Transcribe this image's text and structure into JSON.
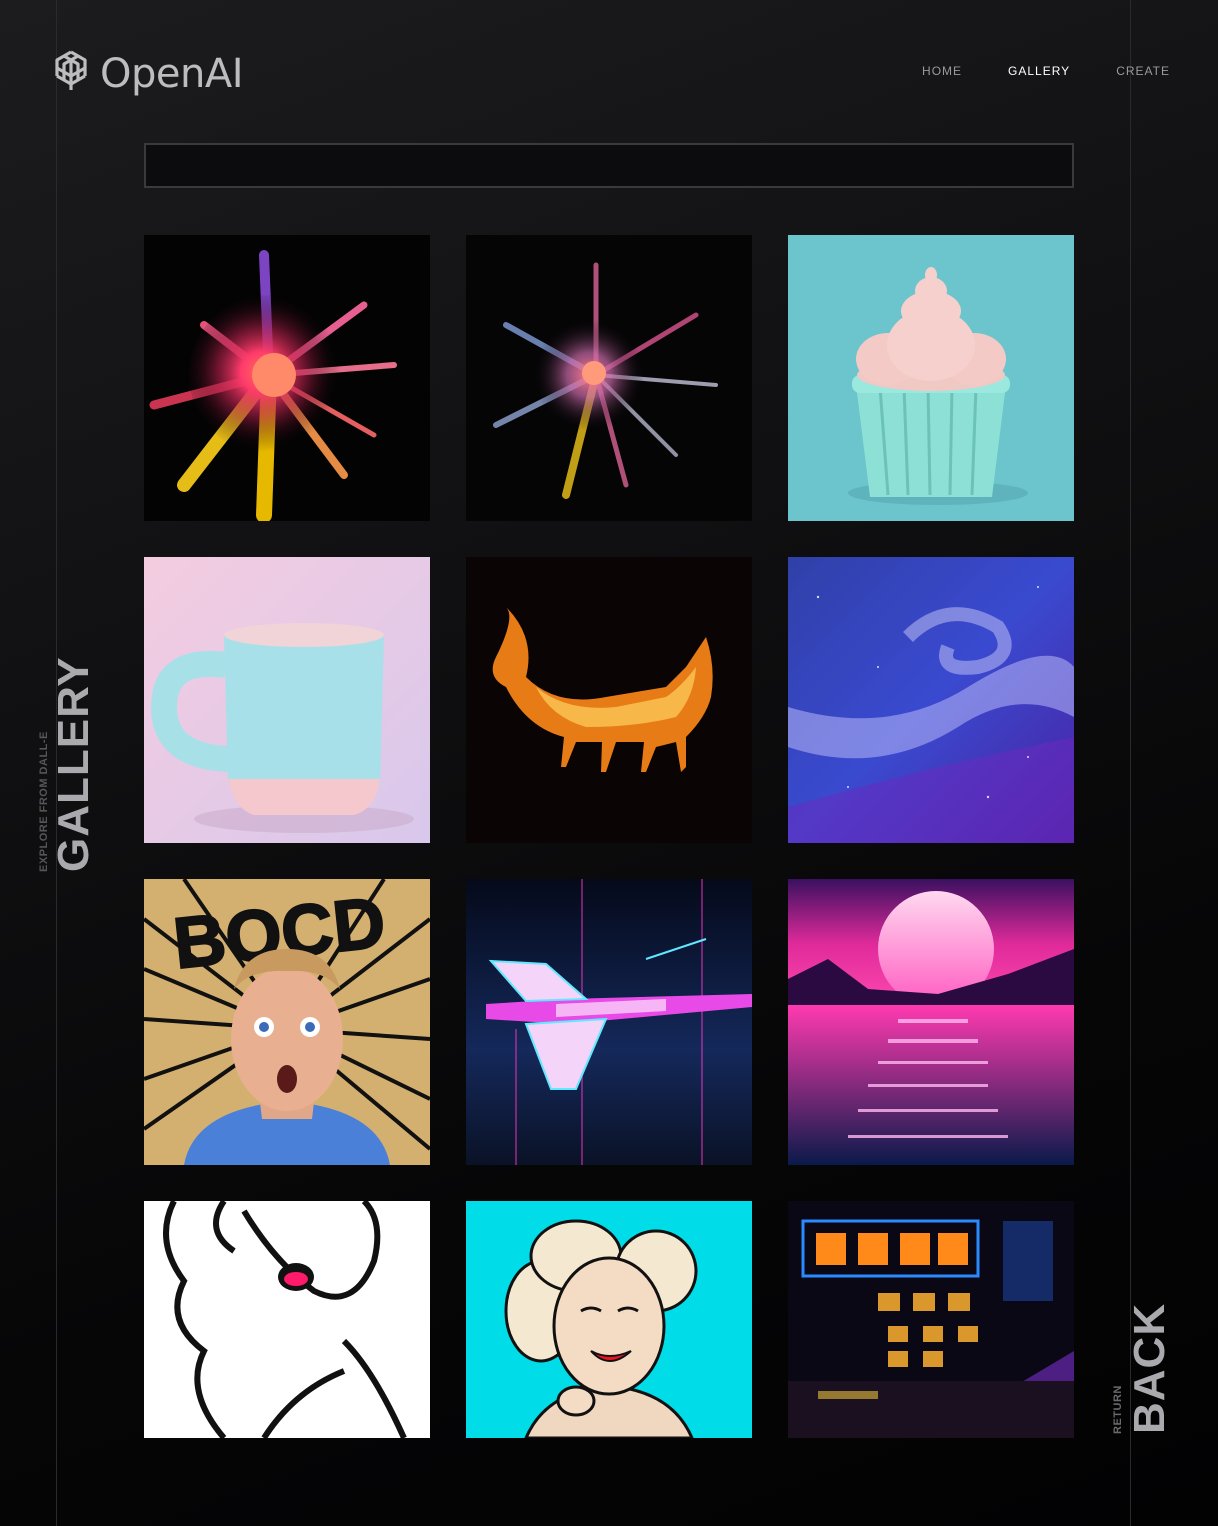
{
  "brand": {
    "name": "OpenAI",
    "icon": "openai-logo-icon"
  },
  "nav": {
    "items": [
      {
        "label": "HOME",
        "active": false
      },
      {
        "label": "GALLERY",
        "active": true
      },
      {
        "label": "CREATE",
        "active": false
      }
    ]
  },
  "search": {
    "value": "",
    "placeholder": ""
  },
  "side_left": {
    "small": "EXPLORE FROM DALL-E",
    "big": "GALLERY"
  },
  "side_right": {
    "small": "RETURN",
    "big": "BACK"
  },
  "gallery": {
    "images": [
      {
        "subject": "colorful powder explosion"
      },
      {
        "subject": "pastel powder explosion"
      },
      {
        "subject": "pink frosted cupcake"
      },
      {
        "subject": "pastel blue mug"
      },
      {
        "subject": "fire fox"
      },
      {
        "subject": "purple galaxy swirl"
      },
      {
        "subject": "comic surprised man",
        "text": "BOCD"
      },
      {
        "subject": "neon spaceship"
      },
      {
        "subject": "synthwave sunset over water"
      },
      {
        "subject": "pop art woman line drawing"
      },
      {
        "subject": "pop art woman on cyan"
      },
      {
        "subject": "neon city street signs"
      }
    ]
  },
  "colors": {
    "background": "#0b0b0c",
    "nav_active": "#ffffff",
    "nav_inactive": "#9a9a9e"
  }
}
